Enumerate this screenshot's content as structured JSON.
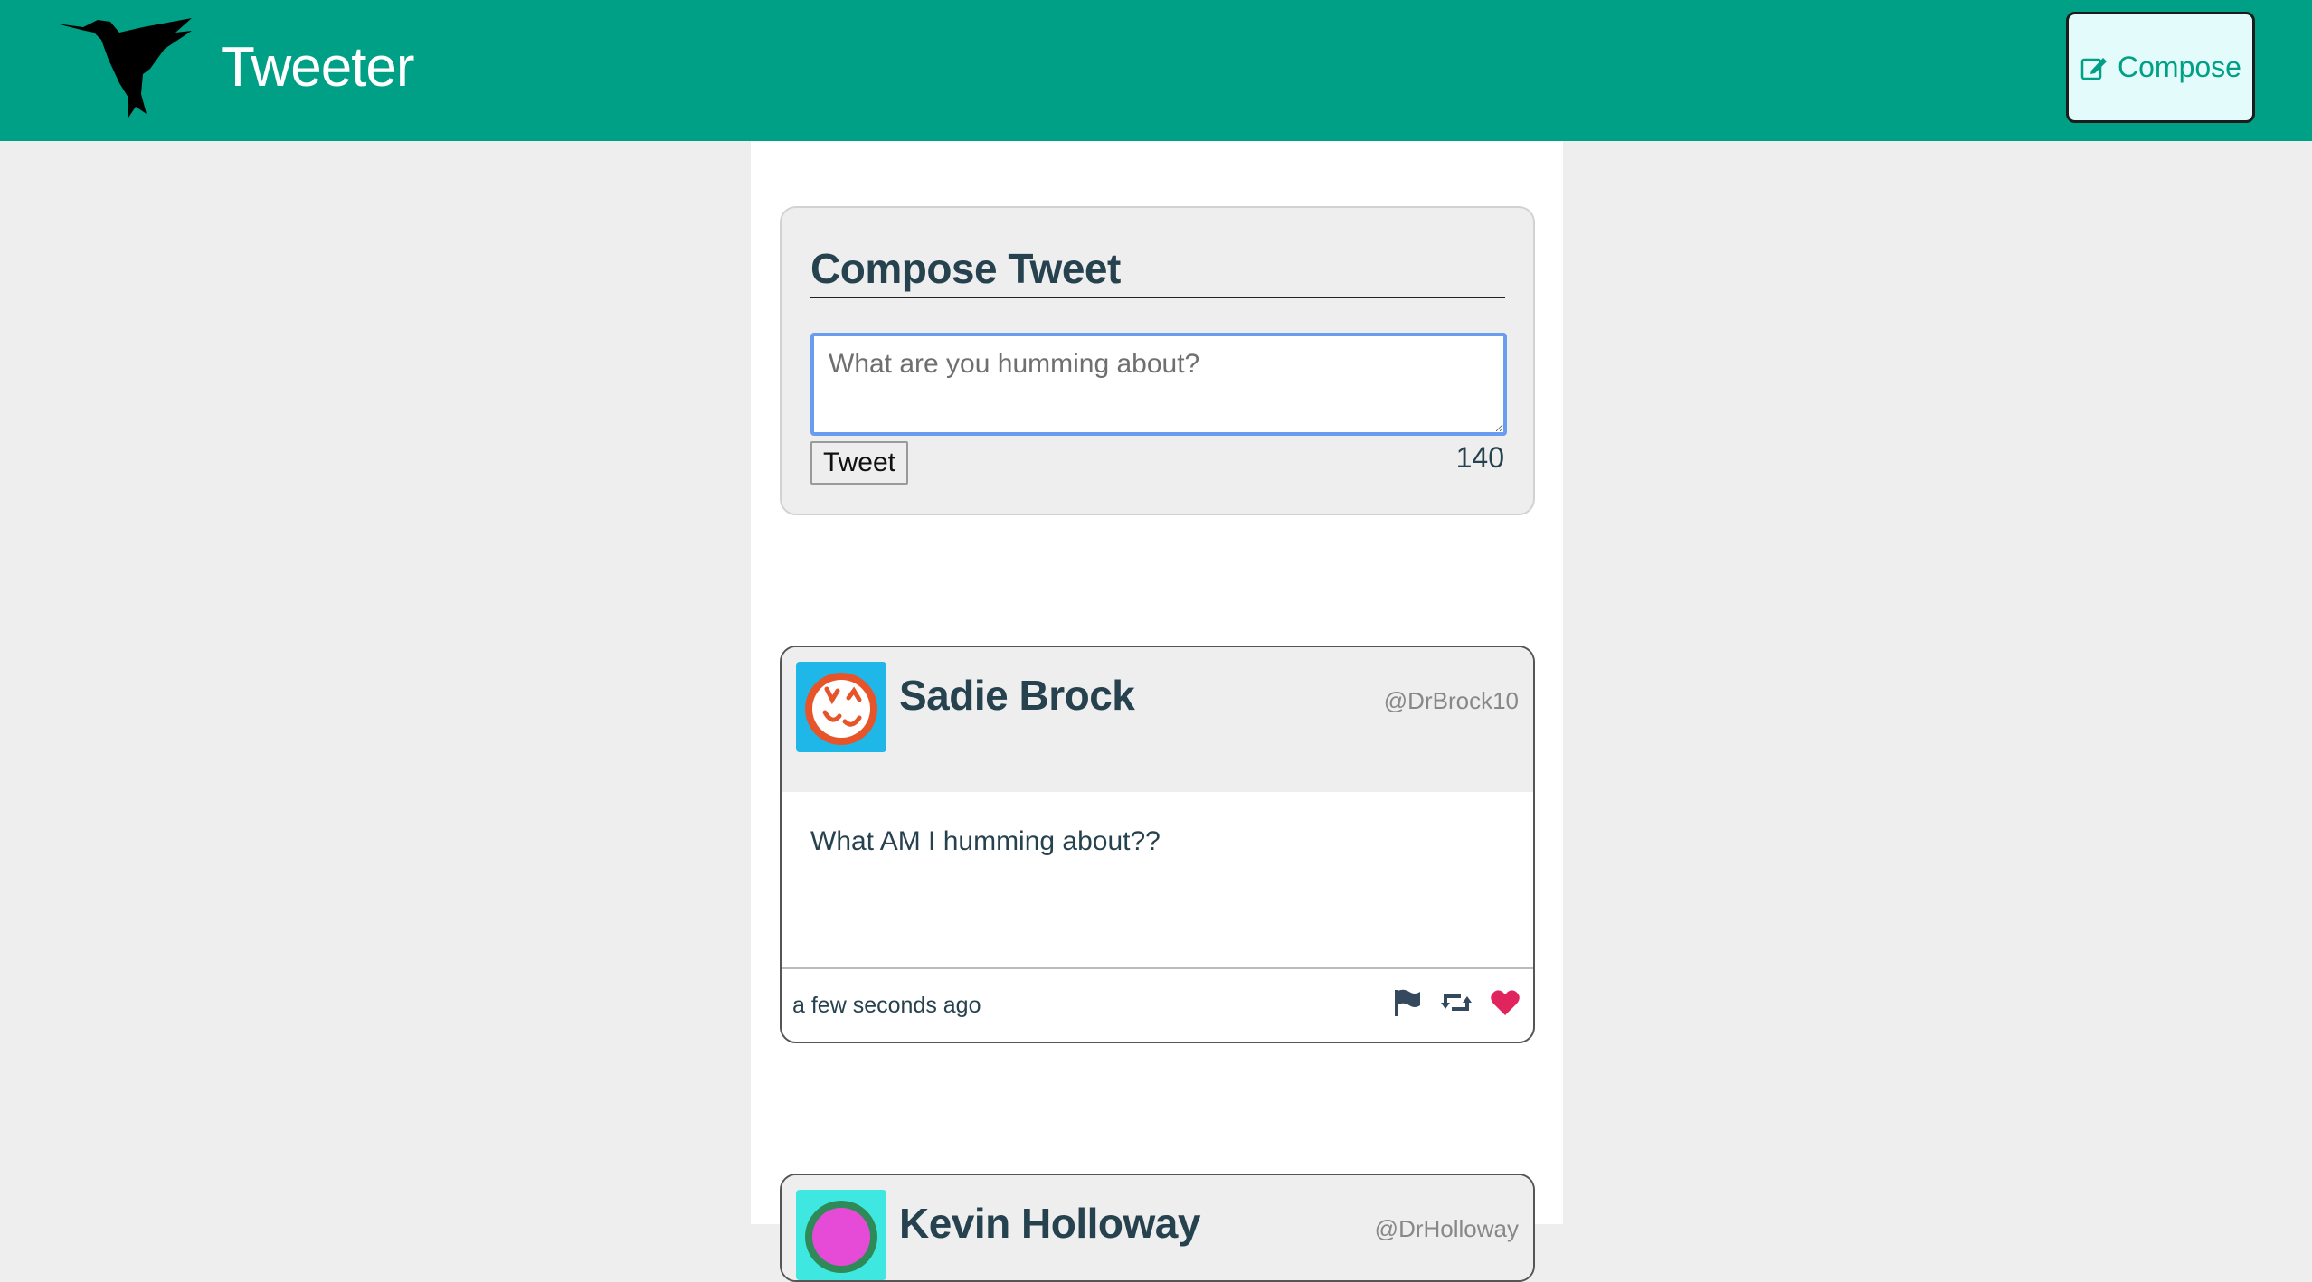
{
  "header": {
    "brand": "Tweeter",
    "compose_label": "Compose",
    "colors": {
      "bar": "#00a087",
      "compose_bg": "#e3fbfb"
    }
  },
  "composer": {
    "title": "Compose Tweet",
    "placeholder": "What are you humming about?",
    "submit_label": "Tweet",
    "counter": "140"
  },
  "tweets": [
    {
      "name": "Sadie Brock",
      "handle": "@DrBrock10",
      "text": "What AM I humming about??",
      "time": "a few seconds ago",
      "avatar_icon": "cracked-egg-avatar-icon",
      "actions": [
        "flag-icon",
        "retweet-icon",
        "heart-icon"
      ],
      "heart_color": "#e0245e"
    },
    {
      "name": "Kevin Holloway",
      "handle": "@DrHolloway",
      "avatar_icon": "avatar-icon"
    }
  ]
}
